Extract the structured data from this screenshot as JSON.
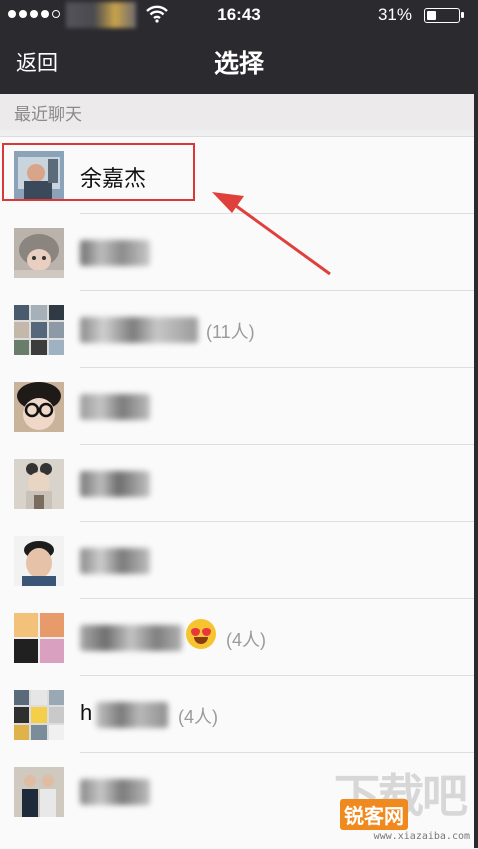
{
  "status_bar": {
    "time": "16:43",
    "battery": "31%",
    "battery_level": 0.31
  },
  "nav": {
    "back_label": "返回",
    "title": "选择"
  },
  "section": {
    "title": "最近聊天"
  },
  "rows": [
    {
      "name": "余嘉杰"
    },
    {
      "name": ""
    },
    {
      "name": "",
      "count": "(11人)"
    },
    {
      "name": ""
    },
    {
      "name": ""
    },
    {
      "name": ""
    },
    {
      "name": "",
      "count": "(4人)"
    },
    {
      "name": "h",
      "count": "(4人)"
    },
    {
      "name": ""
    }
  ],
  "watermark": {
    "badge": "锐客网",
    "url": "www.xiazaiba.com",
    "big": "下载吧"
  },
  "colors": {
    "nav_bg": "#2b2a2f",
    "highlight": "#d9383a",
    "arrow": "#e0403c"
  }
}
